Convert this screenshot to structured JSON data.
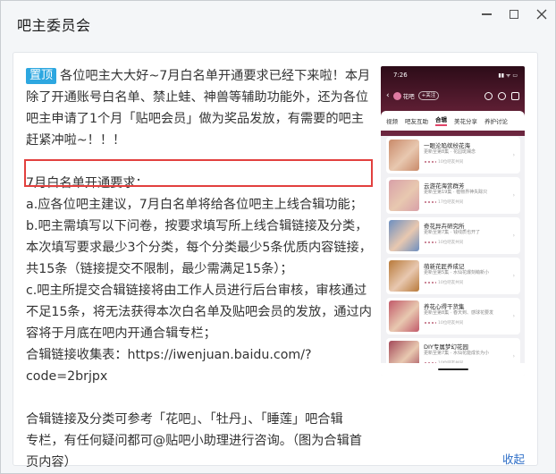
{
  "window": {
    "title": "吧主委员会",
    "min_icon": "minimize-icon",
    "max_icon": "maximize-icon",
    "close_icon": "close-icon"
  },
  "post": {
    "pin_badge": "置顶",
    "intro_lines": [
      "各位吧主大大好~7月白名单开通要求已经下来啦！本月",
      "除了开通账号白名单、禁止蛙、神兽等辅助功能外，还为各位",
      "吧主申请了1个月「贴吧会员」做为奖品发放，有需要的吧主",
      "赶紧冲啦~！！！"
    ],
    "req_lines": [
      "7月白名单开通要求：",
      "a.应各位吧主建议，7月白名单将给各位吧主上线合辑功能；",
      "b.吧主需填写以下问卷，按要求填写所上线合辑链接及分类，",
      "本次填写要求最少3个分类，每个分类最少5条优质内容链接，",
      "共15条（链接提交不限制，最少需满足15条）；",
      "c.吧主所提交合辑链接将由工作人员进行后台审核，审核通过",
      "不足15条，将无法获得本次白名单及贴吧会员的发放，通过内",
      "容将于月底在吧内开通合辑专栏；",
      "合辑链接收集表：https://iwenjuan.baidu.com/?",
      "code=2brjpx"
    ],
    "ref_lines": [
      "合辑链接及分类可参考「花吧」、「牡丹」、「睡莲」吧合辑",
      "专栏，有任何疑问都可@贴吧小助理进行咨询。（图为合辑首",
      "页内容）"
    ],
    "collapse_label": "收起"
  },
  "phone": {
    "time": "7:26",
    "status_right": "▮▮ ᯤ ▭",
    "bar_name": "花吧",
    "follow_label": "+关注",
    "tabs": [
      "视频",
      "吧友互助",
      "合辑",
      "美花分享",
      "养护讨论"
    ],
    "active_tab": 2,
    "cards": [
      {
        "title": "一眼沦陷缤纷花海",
        "sub": "更新至第8集 · 花园斑斓念",
        "meta": "10位吧友共同",
        "color": "#c98a6a"
      },
      {
        "title": "云游花海赏群芳",
        "sub": "更新至第19集 · 植物界神失踪只",
        "meta": "17位吧友共同",
        "color": "#d8a0a8"
      },
      {
        "title": "奇花异卉研究所",
        "sub": "更新至第7集 · 钱线质也开了",
        "meta": "10位吧友共同",
        "color": "#6d8fc0"
      },
      {
        "title": "萌新花匠养成记",
        "sub": "更新至第5集 · 水仙花爆刻萌新小",
        "meta": "10位吧友共同",
        "color": "#b87a3a"
      },
      {
        "title": "养花心得干货集",
        "sub": "更新至第8集 · 春天到、感球花要发",
        "meta": "10位吧友共同",
        "color": "#c25a6a"
      },
      {
        "title": "DIY专属梦幻花园",
        "sub": "更新至第7集 · 水仙花能成长为小",
        "meta": "10位吧友共同",
        "color": "#a44a5a"
      }
    ]
  }
}
